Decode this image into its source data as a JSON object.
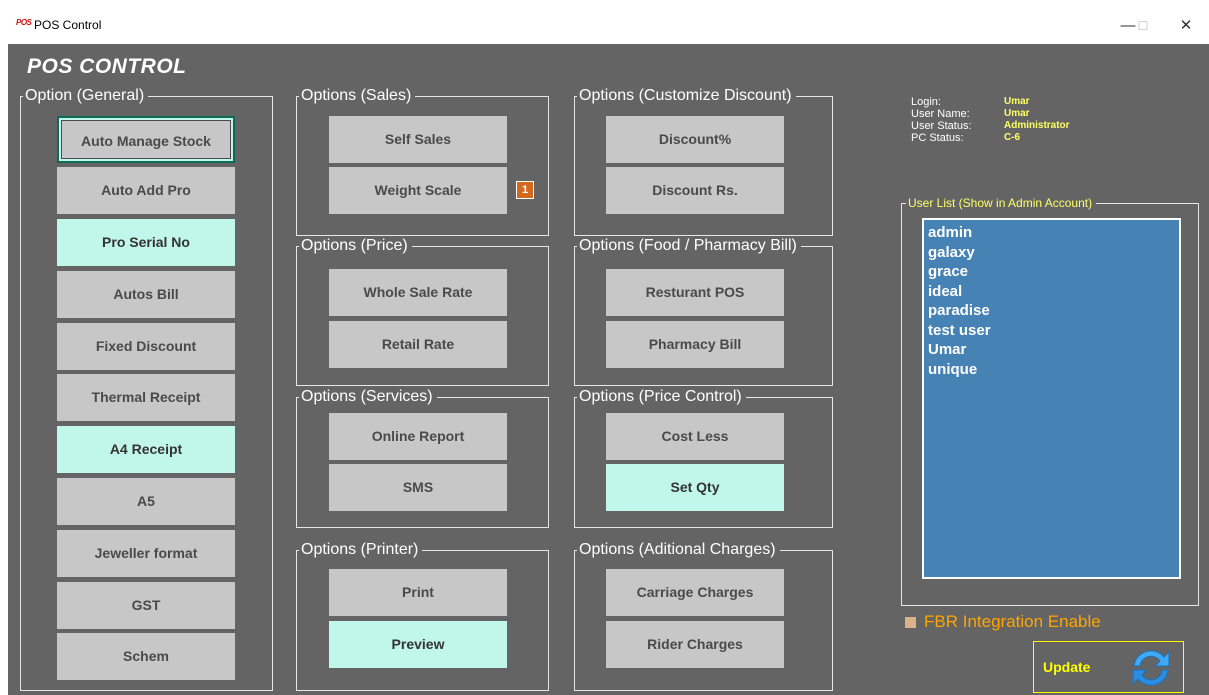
{
  "window": {
    "logo": "POS",
    "title": "POS Control",
    "minimize": "—",
    "maximize": "☐",
    "close": "✕"
  },
  "heading": "POS CONTROL",
  "groups": {
    "general": {
      "title": "Option (General)",
      "buttons": [
        "Auto Manage Stock",
        "Auto Add Pro",
        "Pro Serial No",
        "Autos Bill",
        "Fixed Discount",
        "Thermal Receipt",
        "A4 Receipt",
        "A5",
        "Jeweller format",
        "GST",
        "Schem"
      ],
      "enabled": [
        true,
        false,
        true,
        false,
        false,
        false,
        true,
        false,
        false,
        false,
        false
      ]
    },
    "sales": {
      "title": "Options (Sales)",
      "buttons": [
        "Self Sales",
        "Weight Scale"
      ],
      "enabled": [
        false,
        false
      ],
      "badge": "1"
    },
    "price": {
      "title": "Options (Price)",
      "buttons": [
        "Whole Sale Rate",
        "Retail Rate"
      ],
      "enabled": [
        false,
        false
      ]
    },
    "services": {
      "title": "Options (Services)",
      "buttons": [
        "Online Report",
        "SMS"
      ],
      "enabled": [
        false,
        false
      ]
    },
    "printer": {
      "title": "Options (Printer)",
      "buttons": [
        "Print",
        "Preview"
      ],
      "enabled": [
        false,
        true
      ]
    },
    "discount": {
      "title": "Options (Customize Discount)",
      "buttons": [
        "Discount%",
        "Discount Rs."
      ],
      "enabled": [
        false,
        false
      ]
    },
    "food": {
      "title": "Options (Food / Pharmacy Bill)",
      "buttons": [
        "Resturant POS",
        "Pharmacy Bill"
      ],
      "enabled": [
        false,
        false
      ]
    },
    "price_control": {
      "title": "Options (Price Control)",
      "buttons": [
        "Cost Less",
        "Set Qty"
      ],
      "enabled": [
        false,
        true
      ]
    },
    "charges": {
      "title": "Options (Aditional Charges)",
      "buttons": [
        "Carriage Charges",
        "Rider Charges"
      ],
      "enabled": [
        false,
        false
      ]
    }
  },
  "info": {
    "login_label": "Login:",
    "login_value": "Umar",
    "username_label": "User Name:",
    "username_value": "Umar",
    "status_label": "User Status:",
    "status_value": "Administrator",
    "pc_label": "PC Status:",
    "pc_value": "C-6"
  },
  "user_list": {
    "title": "User List (Show in Admin Account)",
    "users": [
      "admin",
      "galaxy",
      "grace",
      "ideal",
      "paradise",
      "test user",
      "Umar",
      "unique"
    ]
  },
  "fbr": {
    "label": "FBR Integration Enable",
    "checked": false
  },
  "update": {
    "label": "Update",
    "icon": "refresh-icon"
  },
  "colors": {
    "background": "#646464",
    "button": "#c7c7c7",
    "button_on": "#c1f7ea",
    "list": "#4682b4",
    "accent_yellow": "#ffff00",
    "accent_orange": "#ffa500"
  }
}
